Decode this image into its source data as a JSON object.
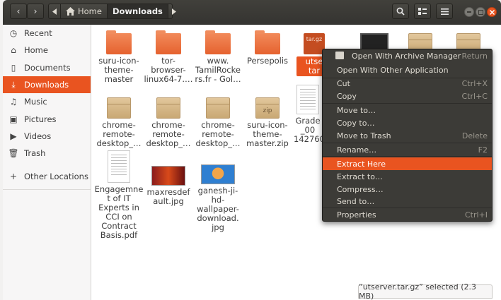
{
  "header": {
    "nav_back_glyph": "‹",
    "nav_forward_glyph": "›",
    "breadcrumb": {
      "home_label": "Home",
      "current_label": "Downloads"
    }
  },
  "sidebar": {
    "items": [
      {
        "label": "Recent",
        "icon": "clock-icon"
      },
      {
        "label": "Home",
        "icon": "home-icon"
      },
      {
        "label": "Documents",
        "icon": "document-icon"
      },
      {
        "label": "Downloads",
        "icon": "download-icon",
        "active": true
      },
      {
        "label": "Music",
        "icon": "music-icon"
      },
      {
        "label": "Pictures",
        "icon": "picture-icon"
      },
      {
        "label": "Videos",
        "icon": "video-icon"
      },
      {
        "label": "Trash",
        "icon": "trash-icon"
      },
      {
        "label": "Other Locations",
        "icon": "plus-icon"
      }
    ]
  },
  "files": [
    {
      "name": "suru-icon-\ntheme-\nmaster",
      "type": "folder"
    },
    {
      "name": "tor-\nbrowser-\nlinux64-7.…",
      "type": "folder"
    },
    {
      "name": "www.\nTamilRocke\nrs.fr - Gol…",
      "type": "folder"
    },
    {
      "name": "Persepolis",
      "type": "folder"
    },
    {
      "name": "utse\ntar",
      "type": "archive",
      "badge": "tar.gz",
      "selected": true
    },
    {
      "name": "chrome-\nremote-\ndesktop_…",
      "type": "box"
    },
    {
      "name": "chrome-\nremote-\ndesktop_…",
      "type": "box"
    },
    {
      "name": "chrome-\nremote-\ndesktop_…",
      "type": "box"
    },
    {
      "name": "suru-icon-\ntheme-\nmaster.zip",
      "type": "zip",
      "badge": "zip"
    },
    {
      "name": "Grade\n_00\n142760",
      "type": "doc"
    },
    {
      "name": "Engagemne\nt of IT\nExperts in\nCCI on\nContract\nBasis.pdf",
      "type": "doc"
    },
    {
      "name": "maxresdef\nault.jpg",
      "type": "image"
    },
    {
      "name": "ganesh-ji-\nhd-\nwallpaper-\ndownload.\njpg",
      "type": "image"
    }
  ],
  "context_menu": {
    "items": [
      {
        "label": "Open With Archive Manager",
        "accel": "Return",
        "icon": "archive-manager-icon"
      },
      {
        "label": "Open With Other Application",
        "accel": ""
      },
      {
        "label": "Cut",
        "accel": "Ctrl+X"
      },
      {
        "label": "Copy",
        "accel": "Ctrl+C"
      },
      {
        "label": "Move to…",
        "accel": ""
      },
      {
        "label": "Copy to…",
        "accel": ""
      },
      {
        "label": "Move to Trash",
        "accel": "Delete"
      },
      {
        "label": "Rename…",
        "accel": "F2"
      },
      {
        "label": "Extract Here",
        "accel": "",
        "highlighted": true
      },
      {
        "label": "Extract to…",
        "accel": ""
      },
      {
        "label": "Compress…",
        "accel": ""
      },
      {
        "label": "Send to…",
        "accel": ""
      },
      {
        "label": "Properties",
        "accel": "Ctrl+I"
      }
    ]
  },
  "status": {
    "text": "“utserver.tar.gz” selected  (2.3 MB)"
  },
  "colors": {
    "accent": "#e95420",
    "header": "#3c3b37",
    "sidebar": "#f7f6f6"
  }
}
